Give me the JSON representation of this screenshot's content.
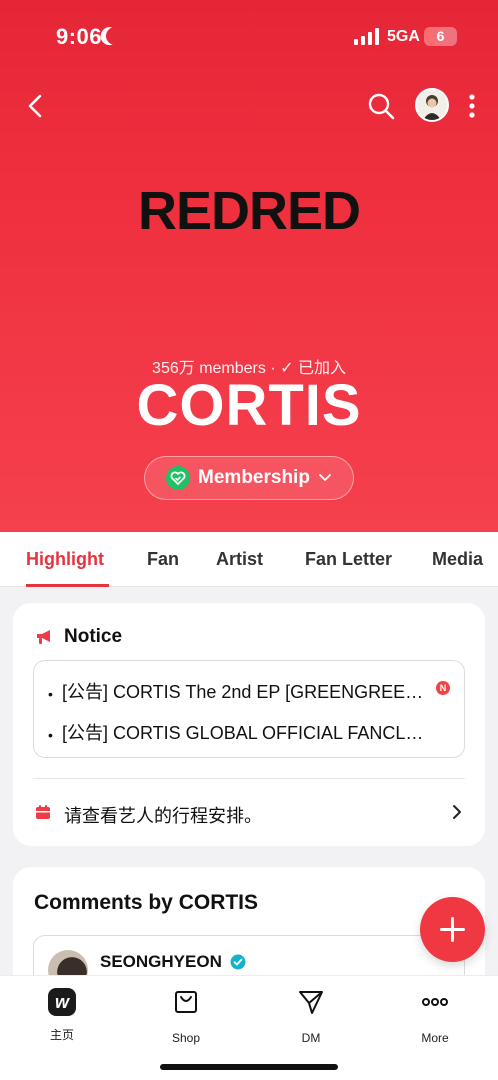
{
  "status_bar": {
    "time": "9:06",
    "network": "5GA",
    "battery": "6"
  },
  "header": {
    "cover_text": "REDRED"
  },
  "community": {
    "members": "356万 members · ✓ 已加入",
    "name": "CORTIS",
    "membership_label": "Membership"
  },
  "tabs": [
    {
      "label": "Highlight",
      "active": true
    },
    {
      "label": "Fan"
    },
    {
      "label": "Artist"
    },
    {
      "label": "Fan Letter"
    },
    {
      "label": "Media"
    }
  ],
  "notice": {
    "title": "Notice",
    "items": [
      {
        "text": "[公告] CORTIS The 2nd EP [GREENGREEN] ...",
        "badge": "N"
      },
      {
        "text": "[公告] CORTIS GLOBAL OFFICIAL FANCLUB ..."
      }
    ],
    "schedule_text": "请查看艺人的行程安排。"
  },
  "comments": {
    "title": "Comments by CORTIS",
    "first_author": "SEONGHYEON"
  },
  "bottom_nav": [
    {
      "label": "主页",
      "icon": "weverse-home-icon"
    },
    {
      "label": "Shop",
      "icon": "shop-bag-icon"
    },
    {
      "label": "DM",
      "icon": "dm-send-icon"
    },
    {
      "label": "More",
      "icon": "more-dots-icon"
    }
  ],
  "colors": {
    "accent": "#e8323e",
    "hero_top": "#e52637",
    "hero_bottom": "#f5404e",
    "membership_green": "#21c063"
  }
}
